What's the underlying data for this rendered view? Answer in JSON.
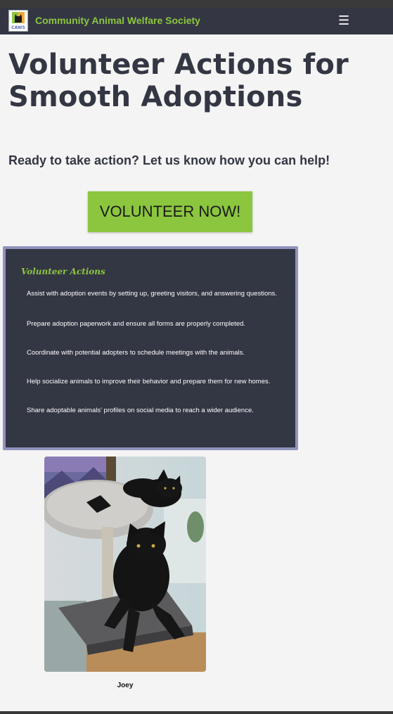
{
  "header": {
    "logo_text": "CAWS",
    "brand": "Community Animal Welfare Society",
    "menu_icon": "hamburger-menu-icon",
    "menu_glyph": "☰"
  },
  "main": {
    "title": "Volunteer Actions for Smooth Adoptions",
    "cta_text": "Ready to take action? Let us know how you can help!",
    "button_label": "VOLUNTEER NOW!"
  },
  "actions": {
    "title": "Volunteer Actions",
    "items": [
      "Assist with adoption events by setting up, greeting visitors, and answering questions.",
      "Prepare adoption paperwork and ensure all forms are properly completed.",
      "Coordinate with potential adopters to schedule meetings with the animals.",
      "Help socialize animals to improve their behavior and prepare them for new homes.",
      "Share adoptable animals' profiles on social media to reach a wider audience."
    ]
  },
  "pet": {
    "name": "Joey"
  },
  "colors": {
    "accent": "#8cc63f",
    "navbar": "#343644",
    "panel": "#333643",
    "panel_border": "#8f93bd",
    "background": "#f4f4f4"
  }
}
